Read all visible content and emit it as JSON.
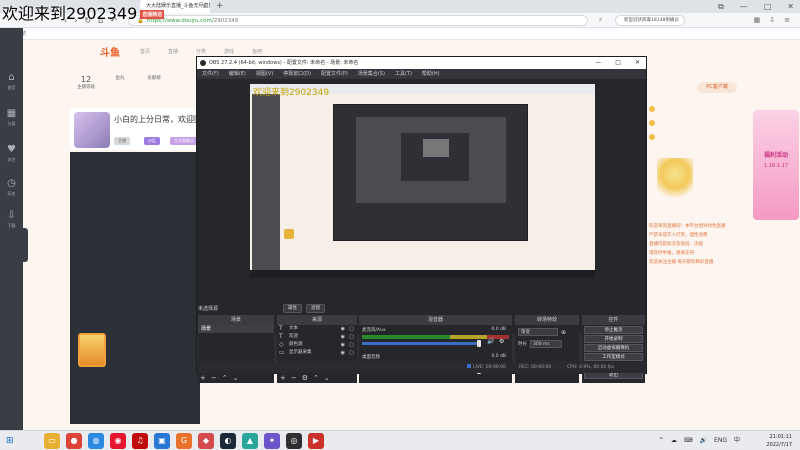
{
  "overlay": {
    "text": "欢迎来到2902349",
    "badge": "直播精选"
  },
  "browser": {
    "tab_title": "大大陆娱乐直播_斗鱼无尽直播",
    "tab_close": "×",
    "new_tab": "+",
    "url_host": "https://www.douyu.com/",
    "url_path": "2902349",
    "search_placeholder": "新型冠状病毒18148例确诊",
    "bookmark": "播放导航",
    "window_controls": [
      "⧉",
      "—",
      "□",
      "✕"
    ]
  },
  "douyu": {
    "logo": "斗鱼",
    "nav": [
      "首页",
      "直播",
      "分类",
      "游戏",
      "鱼吧"
    ],
    "stats": [
      {
        "num": "12",
        "label": "主播等级"
      },
      {
        "num": "",
        "label": "鱼丸"
      },
      {
        "num": "",
        "label": "贡献榜"
      }
    ],
    "room_title": "小白的上分日常，欢迎围观",
    "tags": [
      "主播",
      "分区",
      "大大陆娱乐"
    ],
    "right": {
      "follow_label": "PC客户端",
      "promo_title": "福利活动",
      "promo_date": "1.16-1.17",
      "chat_lines": [
        "欢迎来到直播间！本平台倡导绿色直播",
        "严禁未成年人打赏，理性消费",
        "直播内容如涉及低俗、违规",
        "请及时举报，感谢支持",
        "欢迎关注主播 每天都有精彩直播"
      ]
    },
    "rail": [
      "首页",
      "分类",
      "关注",
      "历史",
      "下载"
    ]
  },
  "obs": {
    "title": "OBS 27.2.4 (64-bit, windows) - 配置文件: 未命名 - 场景: 未命名",
    "menu": [
      "文件(F)",
      "编辑(E)",
      "视图(V)",
      "停靠窗口(D)",
      "配置文件(P)",
      "场景集合(S)",
      "工具(T)",
      "帮助(H)"
    ],
    "preview_overlay": "欢迎来到2902349",
    "no_source_label": "未选择源",
    "props_buttons": [
      "属性",
      "滤镜"
    ],
    "docks": {
      "scenes": {
        "title": "场景",
        "items": [
          "场景"
        ]
      },
      "sources": {
        "title": "来源",
        "items": [
          {
            "icon": "T",
            "name": "文本"
          },
          {
            "icon": "T",
            "name": "欢迎"
          },
          {
            "icon": "◇",
            "name": "颜色源"
          },
          {
            "icon": "▭",
            "name": "显示器采集"
          }
        ]
      },
      "mixer": {
        "title": "混音器",
        "channels": [
          {
            "name": "麦克风/Aux",
            "db": "0.0 dB"
          },
          {
            "name": "桌面音频",
            "db": "0.0 dB"
          }
        ]
      },
      "transitions": {
        "title": "转场特效",
        "type": "渐变",
        "duration_label": "时长",
        "duration": "300 ms"
      },
      "controls": {
        "title": "控件",
        "buttons": [
          "停止推流",
          "开始录制",
          "启动虚拟摄像机",
          "工作室模式",
          "设置",
          "退出"
        ]
      }
    },
    "status": {
      "live": "LIVE: 00:00:00",
      "rec": "REC: 00:00:00",
      "cpu": "CPU: 4.9%, 60.00 fps"
    }
  },
  "taskbar": {
    "apps": [
      {
        "name": "file-explorer",
        "glyph": "▭",
        "color": "#e7b032"
      },
      {
        "name": "chrome",
        "glyph": "●",
        "color": "#db4437"
      },
      {
        "name": "browser-360",
        "glyph": "◍",
        "color": "#2b8ae0"
      },
      {
        "name": "weibo",
        "glyph": "◉",
        "color": "#e6162d"
      },
      {
        "name": "netease",
        "glyph": "♫",
        "color": "#c20c0c"
      },
      {
        "name": "app-blue",
        "glyph": "▣",
        "color": "#2a78d6"
      },
      {
        "name": "app-g",
        "glyph": "G",
        "color": "#e9722a"
      },
      {
        "name": "app-cube",
        "glyph": "◆",
        "color": "#d54a4a"
      },
      {
        "name": "steam",
        "glyph": "◐",
        "color": "#1b2838"
      },
      {
        "name": "app-teal",
        "glyph": "▲",
        "color": "#2aa59a"
      },
      {
        "name": "app-purple",
        "glyph": "✦",
        "color": "#6b55c9"
      },
      {
        "name": "obs",
        "glyph": "◎",
        "color": "#302e31"
      },
      {
        "name": "app-red",
        "glyph": "▶",
        "color": "#c9302c"
      }
    ],
    "tray": [
      "^",
      "☁",
      "⌨",
      "🔊",
      "ENG",
      "中"
    ],
    "time": "21:01:11",
    "date": "2022/7/17"
  }
}
